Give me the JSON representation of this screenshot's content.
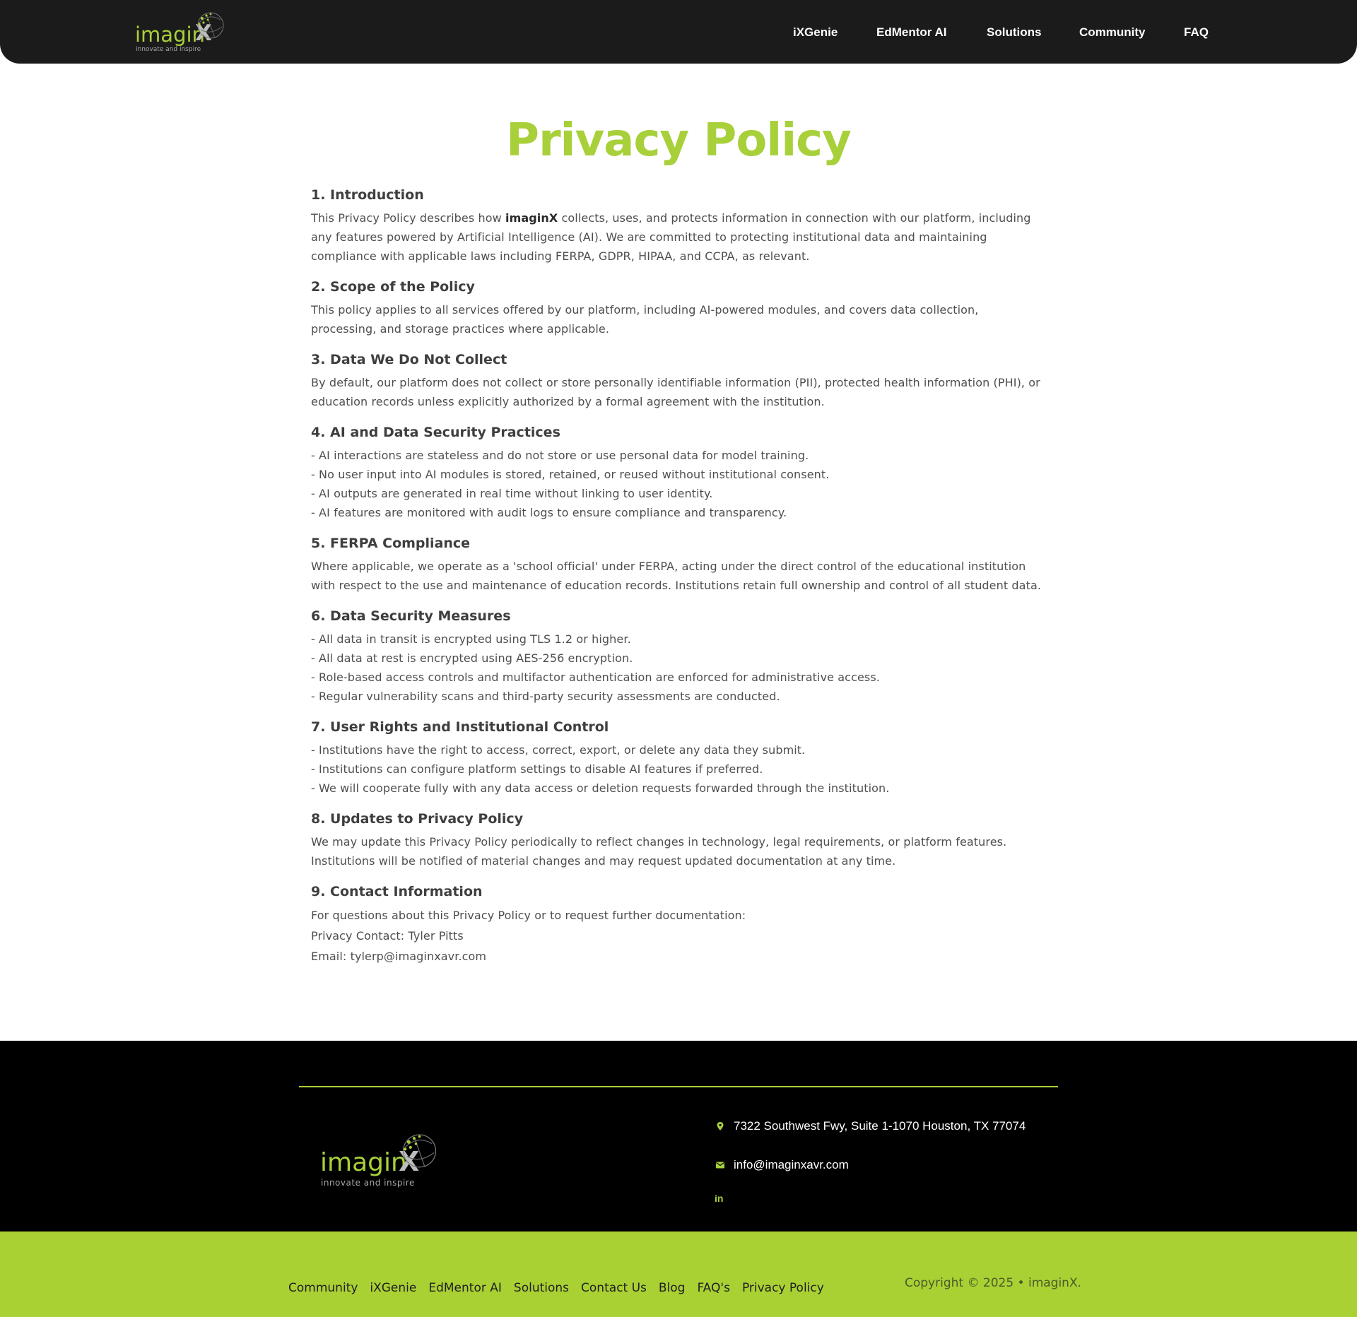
{
  "header": {
    "logo": {
      "word": "imagin",
      "x": "X",
      "tagline": "innovate and inspire"
    },
    "nav": [
      {
        "label": "iXGenie"
      },
      {
        "label": "EdMentor AI"
      },
      {
        "label": "Solutions"
      },
      {
        "label": "Community"
      },
      {
        "label": "FAQ"
      }
    ]
  },
  "main": {
    "title": "Privacy Policy",
    "sections": [
      {
        "heading": "1. Introduction",
        "p_before": "This Privacy Policy describes how ",
        "p_bold": "imaginX",
        "p_after": " collects, uses, and protects information in connection with our platform, including any features powered by Artificial Intelligence (AI). We are committed to protecting institutional data and maintaining compliance with applicable laws including FERPA, GDPR, HIPAA, and CCPA, as relevant."
      },
      {
        "heading": "2. Scope of the Policy",
        "text": "This policy applies to all services offered by our platform, including AI-powered modules, and covers data collection, processing, and storage practices where applicable."
      },
      {
        "heading": "3. Data We Do Not Collect",
        "text": "By default, our platform does not collect or store personally identifiable information (PII), protected health information (PHI), or education records unless explicitly authorized by a formal agreement with the institution."
      },
      {
        "heading": "4. AI and Data Security Practices",
        "items": [
          "- AI interactions are stateless and do not store or use personal data for model training.",
          "- No user input into AI modules is stored, retained, or reused without institutional consent.",
          "- AI outputs are generated in real time without linking to user identity.",
          "- AI features are monitored with audit logs to ensure compliance and transparency."
        ]
      },
      {
        "heading": "5. FERPA Compliance",
        "text": "Where applicable, we operate as a 'school official' under FERPA, acting under the direct control of the educational institution with respect to the use and maintenance of education records. Institutions retain full ownership and control of all student data."
      },
      {
        "heading": "6. Data Security Measures",
        "items": [
          "- All data in transit is encrypted using TLS 1.2 or higher.",
          "- All data at rest is encrypted using AES-256 encryption.",
          "- Role-based access controls and multifactor authentication are enforced for administrative access.",
          "- Regular vulnerability scans and third-party security assessments are conducted."
        ]
      },
      {
        "heading": "7. User Rights and Institutional Control",
        "items": [
          "- Institutions have the right to access, correct, export, or delete any data they submit.",
          "- Institutions can configure platform settings to disable AI features if preferred.",
          "- We will cooperate fully with any data access or deletion requests forwarded through the institution."
        ]
      },
      {
        "heading": "8. Updates to Privacy Policy",
        "text": "We may update this Privacy Policy periodically to reflect changes in technology, legal requirements, or platform features. Institutions will be notified of material changes and may request updated documentation at any time."
      },
      {
        "heading": "9. Contact Information",
        "lines": [
          "For questions about this Privacy Policy or to request further documentation:",
          "Privacy Contact: Tyler Pitts",
          "Email: tylerp@imaginxavr.com"
        ]
      }
    ]
  },
  "footer": {
    "logo": {
      "word": "imagin",
      "x": "X",
      "tagline": "innovate and inspire"
    },
    "address": "7322 Southwest Fwy, Suite 1-1070 Houston, TX 77074",
    "email": "info@imaginxavr.com",
    "social_icon": "in",
    "links": [
      "Community",
      "iXGenie",
      "EdMentor AI",
      "Solutions",
      "Contact Us",
      "Blog",
      "FAQ's",
      "Privacy Policy"
    ],
    "copyright": "Copyright © 2025 • imaginX."
  },
  "colors": {
    "accent": "#a8d03a",
    "header_bg": "#1b1b1b",
    "footer_bg": "#000000",
    "subfooter_bg": "#a9d134"
  },
  "icons": [
    "map-pin-icon",
    "email-icon",
    "linkedin-icon",
    "logo-network-icon"
  ]
}
